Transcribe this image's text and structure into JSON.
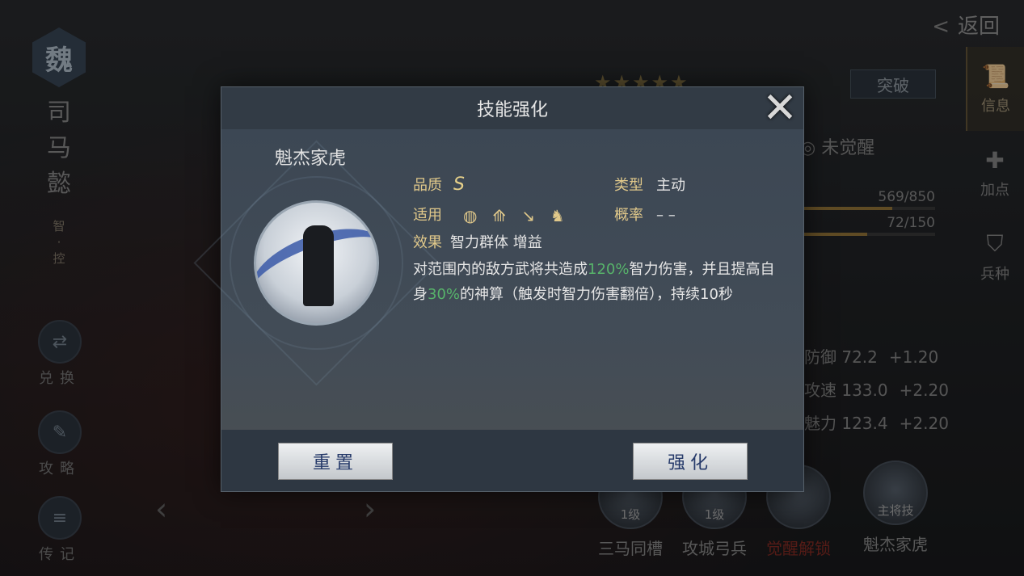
{
  "top": {
    "back_label": "返回"
  },
  "left": {
    "faction": "魏",
    "hero_name": [
      "司",
      "马",
      "懿"
    ],
    "hero_tag": [
      "智",
      "·",
      "控"
    ],
    "side_buttons": [
      {
        "label": "兑换",
        "icon": "exchange-icon"
      },
      {
        "label": "攻略",
        "icon": "scroll-icon"
      },
      {
        "label": "传记",
        "icon": "book-icon"
      }
    ]
  },
  "hero_panel": {
    "stars": "★★★★★",
    "breakthrough_label": "突破",
    "awaken_status": "未觉醒",
    "exp": {
      "text": "569/850",
      "fraction": 0.669
    },
    "level_bar": {
      "text": "72/150",
      "fraction": 0.48
    },
    "stats": [
      {
        "name": "防御",
        "value": "72.2",
        "bonus": "+1.20"
      },
      {
        "name": "攻速",
        "value": "133.0",
        "bonus": "+2.20"
      },
      {
        "name": "魅力",
        "value": "123.4",
        "bonus": "+2.20"
      }
    ],
    "skills": [
      {
        "name": "三马同槽",
        "level": "1级"
      },
      {
        "name": "攻城弓兵",
        "level": "1级"
      },
      {
        "name": "觉醒解锁",
        "level": ""
      },
      {
        "name": "魁杰家虎",
        "level": "主将技"
      }
    ]
  },
  "right_tabs": [
    {
      "label": "信息",
      "icon": "scroll-icon",
      "active": true
    },
    {
      "label": "加点",
      "icon": "points-icon",
      "active": false
    },
    {
      "label": "兵种",
      "icon": "helmet-icon",
      "active": false
    }
  ],
  "modal": {
    "title": "技能强化",
    "skill_name": "魁杰家虎",
    "quality_label": "品质",
    "quality_value": "S",
    "type_label": "类型",
    "type_value": "主动",
    "applicable_label": "适用",
    "applicable_icons": [
      "shield-unit-icon",
      "bow-unit-icon",
      "spear-unit-icon",
      "cavalry-unit-icon"
    ],
    "chance_label": "概率",
    "chance_value": "– –",
    "effect_label": "效果",
    "effect_value": "智力群体 增益",
    "description": {
      "p1": "对范围内的敌方武将共造成",
      "h1": "120%",
      "p2": "智力伤害，并且提高自身",
      "h2": "30%",
      "p3": "的神算（触发时智力伤害翻倍），持续10秒"
    },
    "reset_label": "重置",
    "enhance_label": "强化"
  }
}
